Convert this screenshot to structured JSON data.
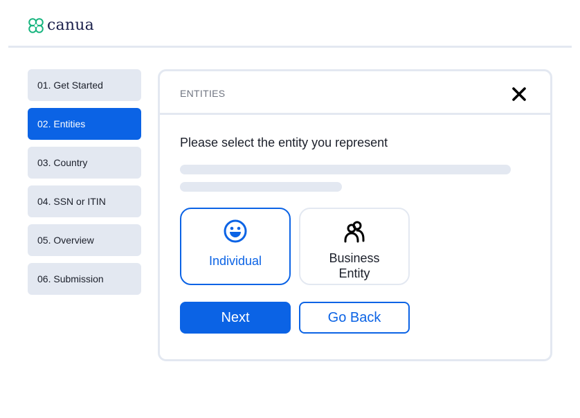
{
  "brand": {
    "name": "canua",
    "logo_icon": "clover-icon",
    "color": "#16b47e"
  },
  "steps": [
    {
      "label": "01. Get Started",
      "active": false
    },
    {
      "label": "02. Entities",
      "active": true
    },
    {
      "label": "03. Country",
      "active": false
    },
    {
      "label": "04. SSN or ITIN",
      "active": false
    },
    {
      "label": "05. Overview",
      "active": false
    },
    {
      "label": "06. Submission",
      "active": false
    }
  ],
  "card": {
    "title": "ENTITIES",
    "close_icon": "close-icon",
    "question": "Please select the entity you represent",
    "options": [
      {
        "label": "Individual",
        "icon": "smiley-icon",
        "selected": true
      },
      {
        "label": "Business Entity",
        "icon": "users-icon",
        "selected": false
      }
    ],
    "next_label": "Next",
    "back_label": "Go Back"
  },
  "colors": {
    "accent": "#0b63e5",
    "muted": "#e3e8f1",
    "text": "#1b1f2a"
  }
}
